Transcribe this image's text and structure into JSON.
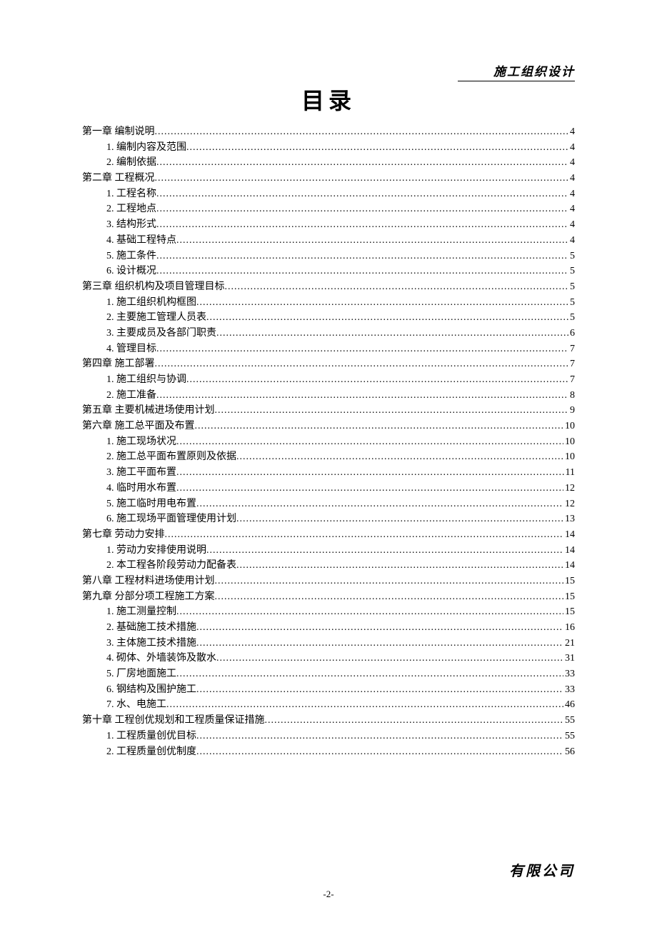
{
  "header": {
    "right": "施工组织设计"
  },
  "title": "目录",
  "toc": [
    {
      "level": 0,
      "label": "第一章 编制说明",
      "page": "4"
    },
    {
      "level": 1,
      "label": "1. 编制内容及范围 ",
      "page": "4"
    },
    {
      "level": 1,
      "label": "2. 编制依据 ",
      "page": "4"
    },
    {
      "level": 0,
      "label": "第二章 工程概况",
      "page": " 4"
    },
    {
      "level": 1,
      "label": "1. 工程名称 ",
      "page": "4"
    },
    {
      "level": 1,
      "label": "2. 工程地点 ",
      "page": "4"
    },
    {
      "level": 1,
      "label": "3. 结构形式 ",
      "page": "4"
    },
    {
      "level": 1,
      "label": "4. 基础工程特点 ",
      "page": " 4"
    },
    {
      "level": 1,
      "label": "5. 施工条件 ",
      "page": "5"
    },
    {
      "level": 1,
      "label": "6. 设计概况 ",
      "page": "5"
    },
    {
      "level": 0,
      "label": "第三章 组织机构及项目管理目标 ",
      "page": "5"
    },
    {
      "level": 1,
      "label": "1. 施工组织机构框图 ",
      "page": " 5"
    },
    {
      "level": 1,
      "label": "2. 主要施工管理人员表 ",
      "page": "5"
    },
    {
      "level": 1,
      "label": "3. 主要成员及各部门职责 ",
      "page": "6"
    },
    {
      "level": 1,
      "label": "4. 管理目标 ",
      "page": "7"
    },
    {
      "level": 0,
      "label": "第四章 施工部署",
      "page": "7"
    },
    {
      "level": 1,
      "label": "1. 施工组织与协调 ",
      "page": "7"
    },
    {
      "level": 1,
      "label": "2. 施工准备 ",
      "page": "8"
    },
    {
      "level": 0,
      "label": "第五章 主要机械进场使用计划",
      "page": "9"
    },
    {
      "level": 0,
      "label": "第六章 施工总平面及布置",
      "page": "10"
    },
    {
      "level": 1,
      "label": "1. 施工现场状况 ",
      "page": "10"
    },
    {
      "level": 1,
      "label": "2. 施工总平面布置原则及依据 ",
      "page": "10"
    },
    {
      "level": 1,
      "label": "3. 施工平面布置 ",
      "page": "11"
    },
    {
      "level": 1,
      "label": "4. 临时用水布置 ",
      "page": "12"
    },
    {
      "level": 1,
      "label": "5. 施工临时用电布置 ",
      "page": "12"
    },
    {
      "level": 1,
      "label": "6. 施工现场平面管理使用计划 ",
      "page": "13"
    },
    {
      "level": 0,
      "label": "第七章 劳动力安排",
      "page": "14"
    },
    {
      "level": 1,
      "label": "1. 劳动力安排使用说明 ",
      "page": "14"
    },
    {
      "level": 1,
      "label": "2. 本工程各阶段劳动力配备表 ",
      "page": " 14"
    },
    {
      "level": 0,
      "label": "第八章 工程材料进场使用计划",
      "page": "15"
    },
    {
      "level": 0,
      "label": "第九章 分部分项工程施工方案",
      "page": "15"
    },
    {
      "level": 1,
      "label": "1. 施工测量控制 ",
      "page": "15"
    },
    {
      "level": 1,
      "label": "2. 基础施工技术措施 ",
      "page": "16"
    },
    {
      "level": 1,
      "label": "3. 主体施工技术措施 ",
      "page": "21"
    },
    {
      "level": 1,
      "label": "4. 砌体、外墙装饰及散水 ",
      "page": "31"
    },
    {
      "level": 1,
      "label": "5. 厂房地面施工 ",
      "page": "33"
    },
    {
      "level": 1,
      "label": "6. 钢结构及围护施工 ",
      "page": "33"
    },
    {
      "level": 1,
      "label": "7. 水、电施工 ",
      "page": " 46"
    },
    {
      "level": 0,
      "label": "第十章 工程创优规划和工程质量保证措施",
      "page": "55"
    },
    {
      "level": 1,
      "label": "1. 工程质量创优目标 ",
      "page": "55"
    },
    {
      "level": 1,
      "label": "2. 工程质量创优制度 ",
      "page": "56"
    }
  ],
  "footer": {
    "right": "有限公司",
    "pageNum": "-2-"
  }
}
